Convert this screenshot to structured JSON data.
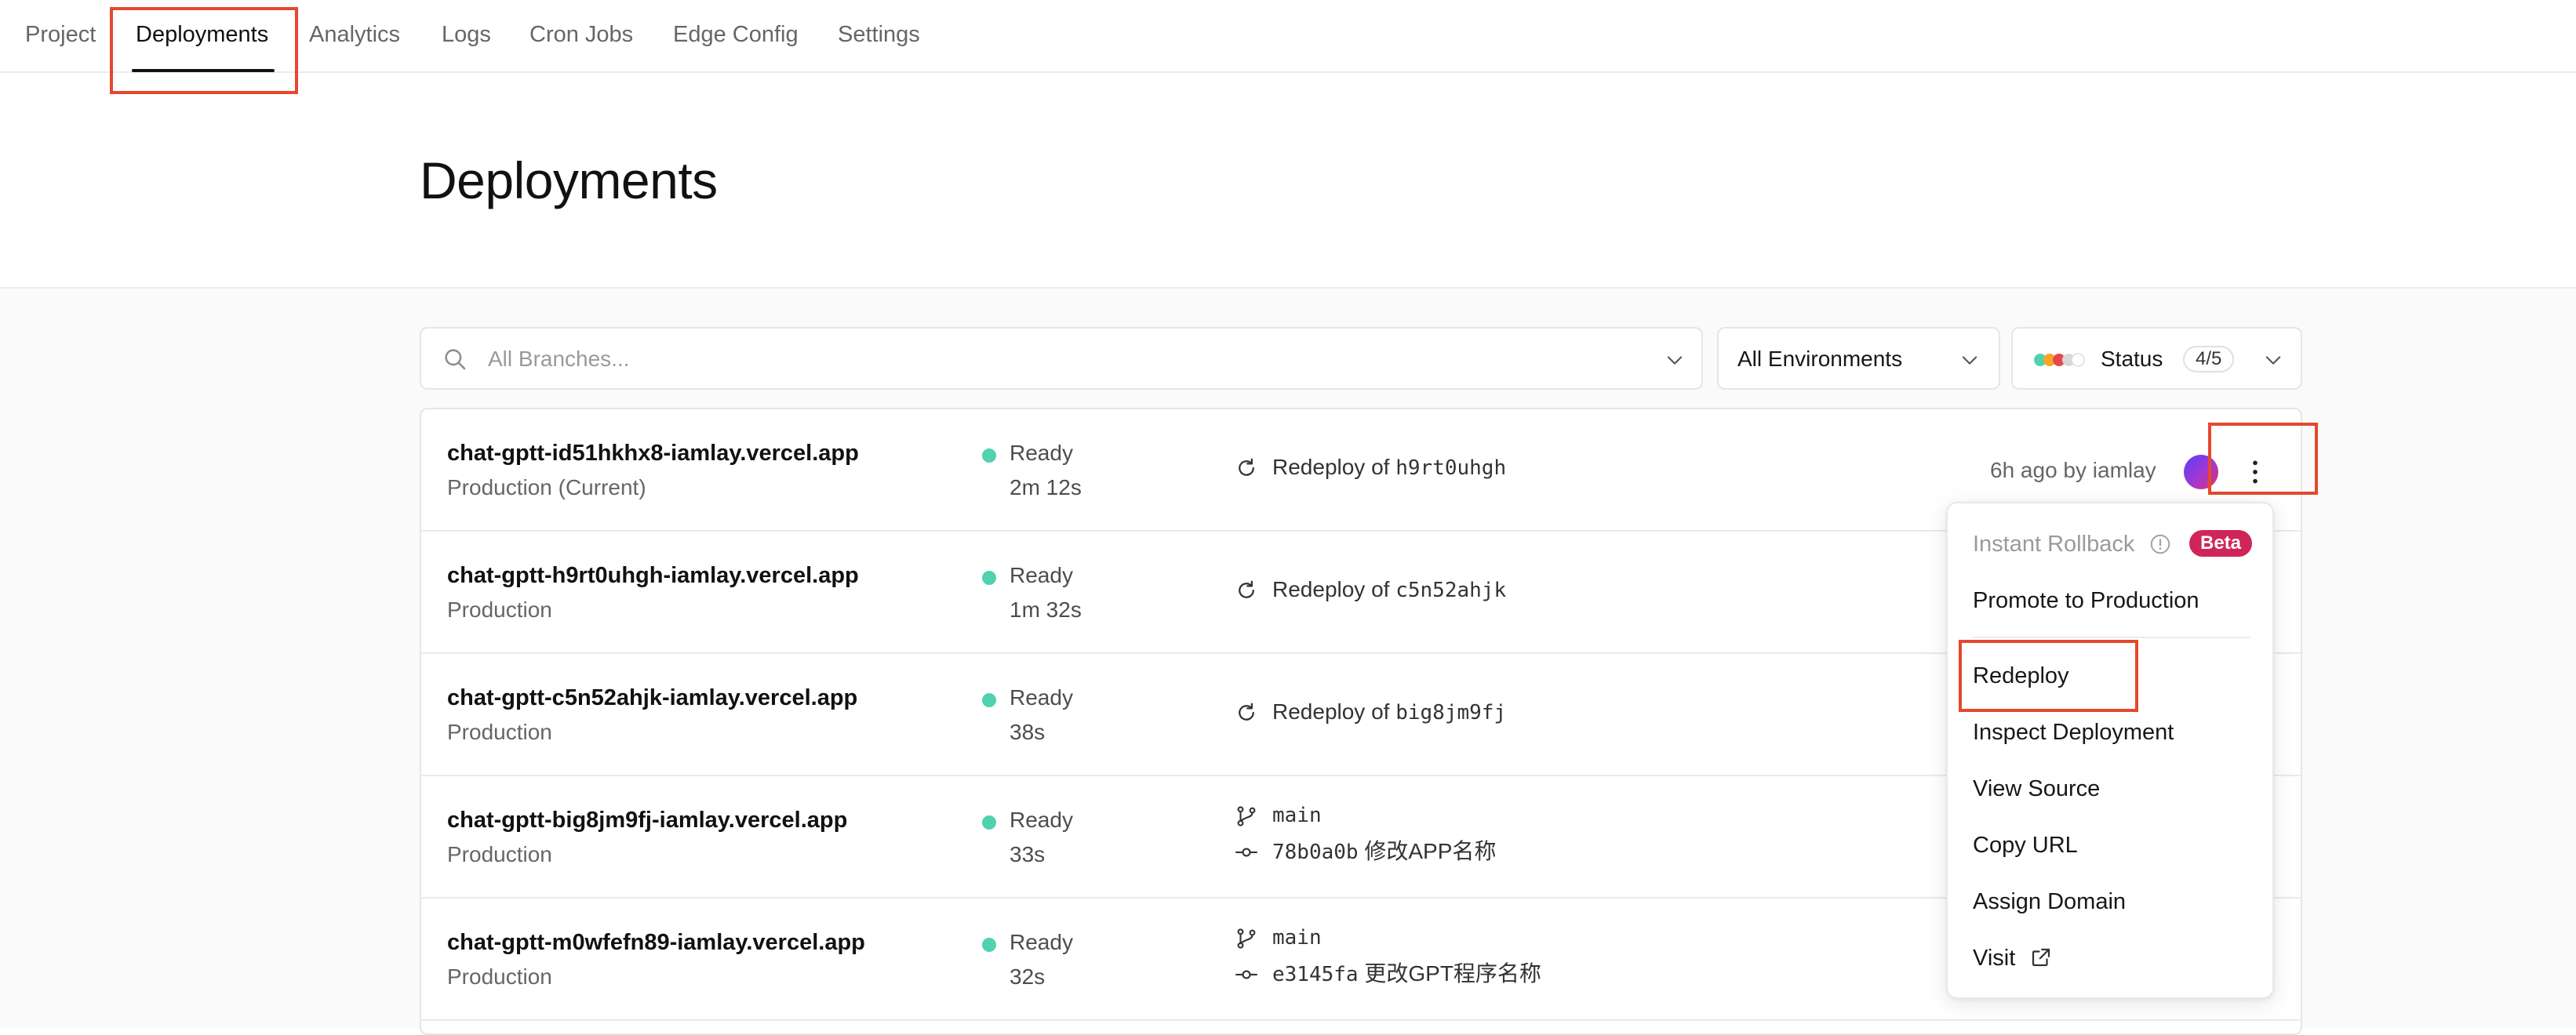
{
  "nav": {
    "tabs": [
      "Project",
      "Deployments",
      "Analytics",
      "Logs",
      "Cron Jobs",
      "Edge Config",
      "Settings"
    ],
    "active_tab": "Deployments"
  },
  "page": {
    "title": "Deployments"
  },
  "filters": {
    "search_placeholder": "All Branches...",
    "environment": "All Environments",
    "status_label": "Status",
    "status_count": "4/5"
  },
  "deployments": [
    {
      "name": "chat-gptt-id51hkhx8-iamlay.vercel.app",
      "environment": "Production (Current)",
      "state": "Ready",
      "duration": "2m 12s",
      "source_type": "redeploy",
      "redeploy_prefix": "Redeploy of",
      "redeploy_id": "h9rt0uhgh",
      "meta": "6h ago by iamlay"
    },
    {
      "name": "chat-gptt-h9rt0uhgh-iamlay.vercel.app",
      "environment": "Production",
      "state": "Ready",
      "duration": "1m 32s",
      "source_type": "redeploy",
      "redeploy_prefix": "Redeploy of",
      "redeploy_id": "c5n52ahjk"
    },
    {
      "name": "chat-gptt-c5n52ahjk-iamlay.vercel.app",
      "environment": "Production",
      "state": "Ready",
      "duration": "38s",
      "source_type": "redeploy",
      "redeploy_prefix": "Redeploy of",
      "redeploy_id": "big8jm9fj"
    },
    {
      "name": "chat-gptt-big8jm9fj-iamlay.vercel.app",
      "environment": "Production",
      "state": "Ready",
      "duration": "33s",
      "source_type": "git",
      "branch": "main",
      "commit_hash": "78b0a0b",
      "commit_message": "修改APP名称"
    },
    {
      "name": "chat-gptt-m0wfefn89-iamlay.vercel.app",
      "environment": "Production",
      "state": "Ready",
      "duration": "32s",
      "source_type": "git",
      "branch": "main",
      "commit_hash": "e3145fa",
      "commit_message": "更改GPT程序名称"
    }
  ],
  "menu": {
    "instant_rollback": "Instant Rollback",
    "beta_badge": "Beta",
    "promote": "Promote to Production",
    "redeploy": "Redeploy",
    "inspect": "Inspect Deployment",
    "view_source": "View Source",
    "copy_url": "Copy URL",
    "assign_domain": "Assign Domain",
    "visit": "Visit"
  },
  "colors": {
    "ready_dot": "#50d2b0",
    "highlight_box": "#e5482d",
    "beta_badge": "#cf2558"
  },
  "icons": [
    "search-icon",
    "chevron-down-icon",
    "status-dots-icon",
    "redeploy-icon",
    "branch-icon",
    "commit-icon",
    "more-vertical-icon",
    "info-icon",
    "external-link-icon"
  ]
}
